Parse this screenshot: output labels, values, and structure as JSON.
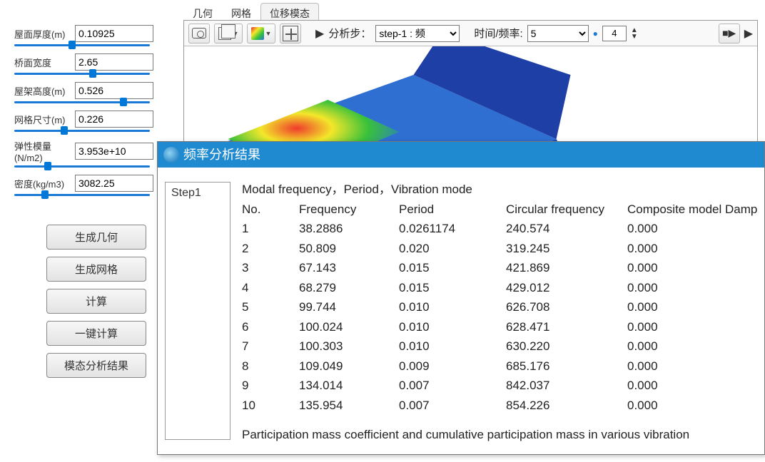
{
  "params": [
    {
      "label": "屋面厚度(m)",
      "value": "0.10925",
      "pos": 40
    },
    {
      "label": "桥面宽度",
      "value": "2.65",
      "pos": 55
    },
    {
      "label": "屋架高度(m)",
      "value": "0.526",
      "pos": 78
    },
    {
      "label": "网格尺寸(m)",
      "value": "0.226",
      "pos": 34
    },
    {
      "label": "弹性模量(N/m2)",
      "value": "3.953e+10",
      "pos": 22
    },
    {
      "label": "密度(kg/m3)",
      "value": "3082.25",
      "pos": 20
    }
  ],
  "buttons": {
    "gen_geom": "生成几何",
    "gen_mesh": "生成网格",
    "compute": "计算",
    "one_click": "一键计算",
    "modal_result": "模态分析结果"
  },
  "tabs": {
    "geom": "几何",
    "mesh": "网格",
    "disp": "位移模态"
  },
  "toolbar": {
    "step_label": "分析步：",
    "step_value": "step-1 : 频",
    "time_label": "时间/频率:",
    "time_value": "5",
    "spin_value": "4"
  },
  "modal": {
    "title": "频率分析结果",
    "step_col": "Step1",
    "heading": "Modal frequency，Period，Vibration mode",
    "cols": {
      "no": "No.",
      "freq": "Frequency",
      "period": "Period",
      "circ": "Circular frequency",
      "damp": "Composite model Damp"
    },
    "rows": [
      {
        "no": "1",
        "freq": "38.2886",
        "period": "0.0261174",
        "circ": "240.574",
        "damp": "0.000"
      },
      {
        "no": "2",
        "freq": "50.809",
        "period": "0.020",
        "circ": "319.245",
        "damp": "0.000"
      },
      {
        "no": "3",
        "freq": "67.143",
        "period": "0.015",
        "circ": "421.869",
        "damp": "0.000"
      },
      {
        "no": "4",
        "freq": "68.279",
        "period": "0.015",
        "circ": "429.012",
        "damp": "0.000"
      },
      {
        "no": "5",
        "freq": "99.744",
        "period": "0.010",
        "circ": "626.708",
        "damp": "0.000"
      },
      {
        "no": "6",
        "freq": "100.024",
        "period": "0.010",
        "circ": "628.471",
        "damp": "0.000"
      },
      {
        "no": "7",
        "freq": "100.303",
        "period": "0.010",
        "circ": "630.220",
        "damp": "0.000"
      },
      {
        "no": "8",
        "freq": "109.049",
        "period": "0.009",
        "circ": "685.176",
        "damp": "0.000"
      },
      {
        "no": "9",
        "freq": "134.014",
        "period": "0.007",
        "circ": "842.037",
        "damp": "0.000"
      },
      {
        "no": "10",
        "freq": "135.954",
        "period": "0.007",
        "circ": "854.226",
        "damp": "0.000"
      }
    ],
    "footer": "Participation mass coefficient and cumulative participation mass in various vibration"
  }
}
